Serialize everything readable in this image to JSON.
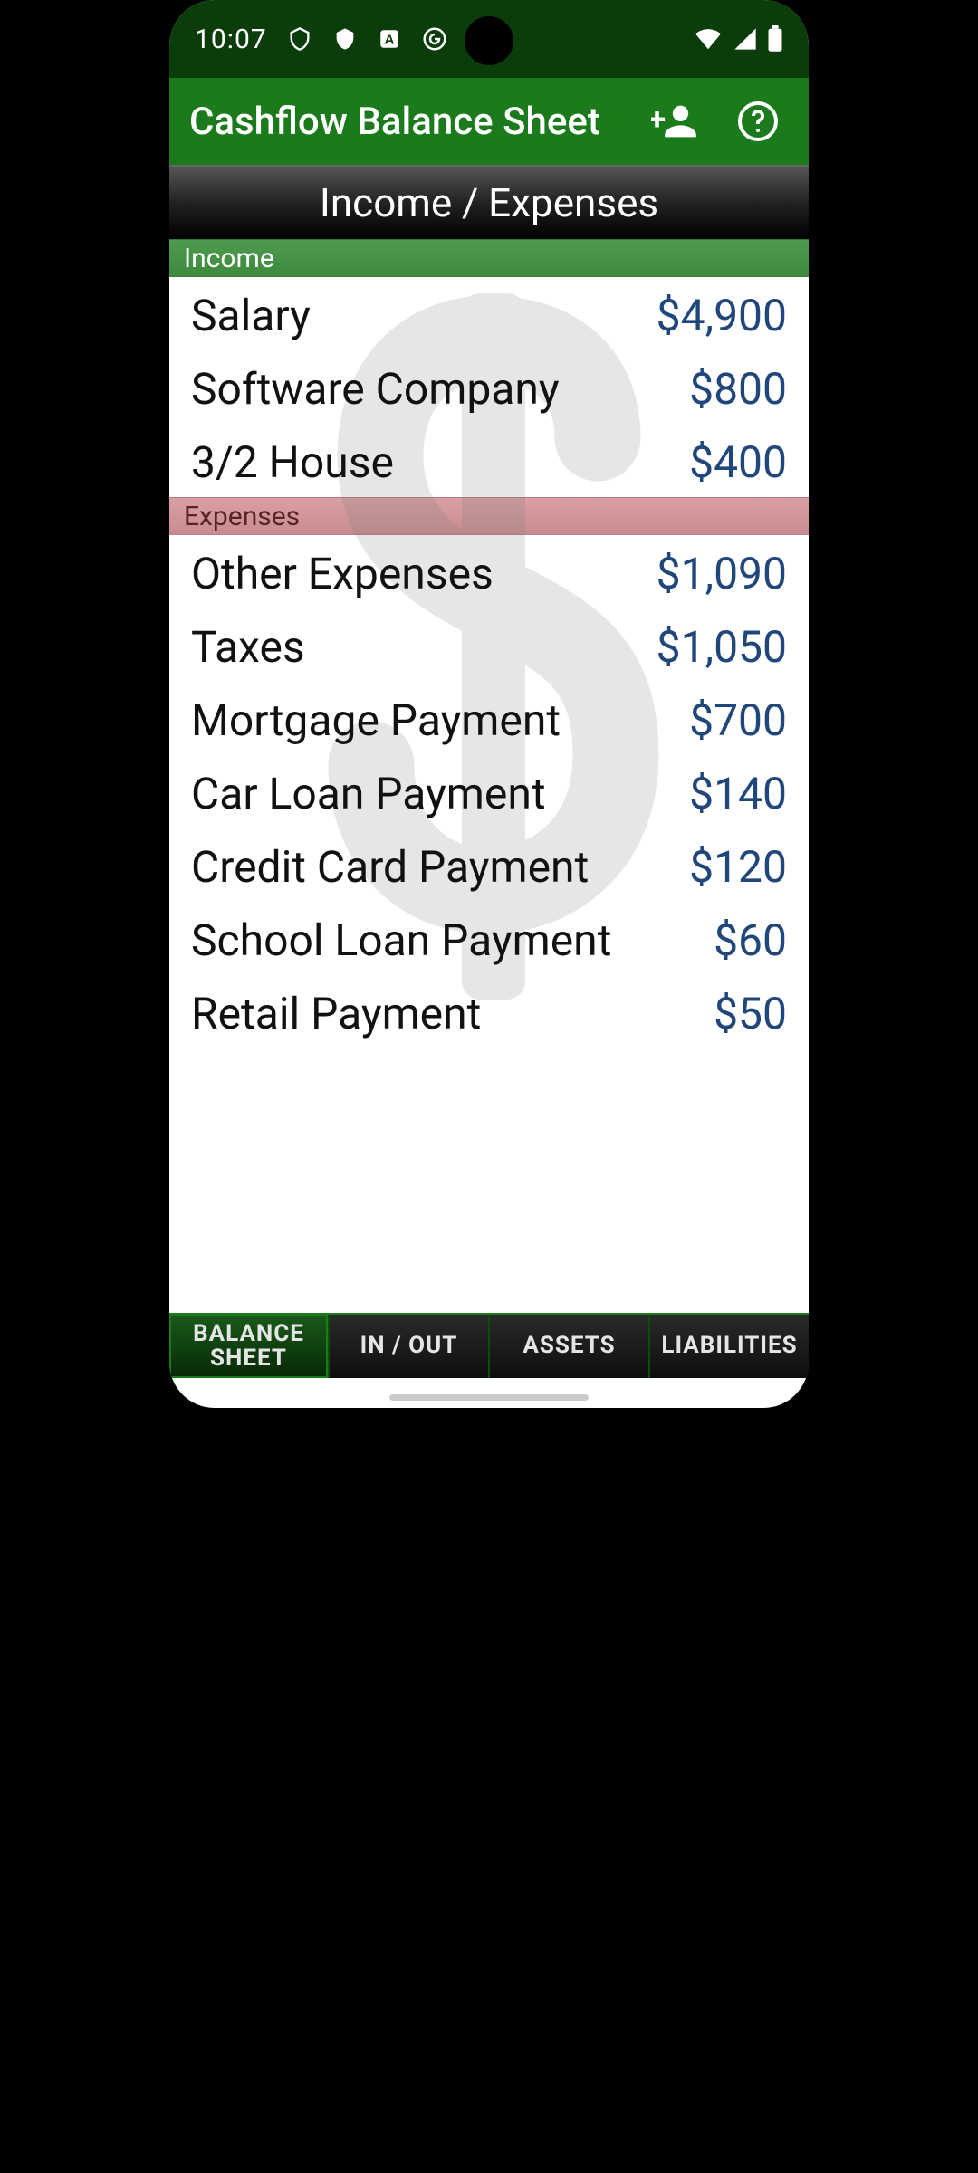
{
  "status": {
    "time": "10:07"
  },
  "appbar": {
    "title": "Cashflow Balance Sheet"
  },
  "heading": "Income / Expenses",
  "groups": {
    "income": {
      "label": "Income",
      "items": [
        {
          "label": "Salary",
          "value": "$4,900"
        },
        {
          "label": "Software Company",
          "value": "$800"
        },
        {
          "label": "3/2 House",
          "value": "$400"
        }
      ]
    },
    "expenses": {
      "label": "Expenses",
      "items": [
        {
          "label": "Other Expenses",
          "value": "$1,090"
        },
        {
          "label": "Taxes",
          "value": "$1,050"
        },
        {
          "label": "Mortgage Payment",
          "value": "$700"
        },
        {
          "label": "Car Loan Payment",
          "value": "$140"
        },
        {
          "label": "Credit Card Payment",
          "value": "$120"
        },
        {
          "label": "School Loan Payment",
          "value": "$60"
        },
        {
          "label": "Retail Payment",
          "value": "$50"
        }
      ]
    }
  },
  "tabs": [
    {
      "label": "BALANCE\nSHEET",
      "active": true
    },
    {
      "label": "IN / OUT",
      "active": false
    },
    {
      "label": "ASSETS",
      "active": false
    },
    {
      "label": "LIABILITIES",
      "active": false
    }
  ]
}
